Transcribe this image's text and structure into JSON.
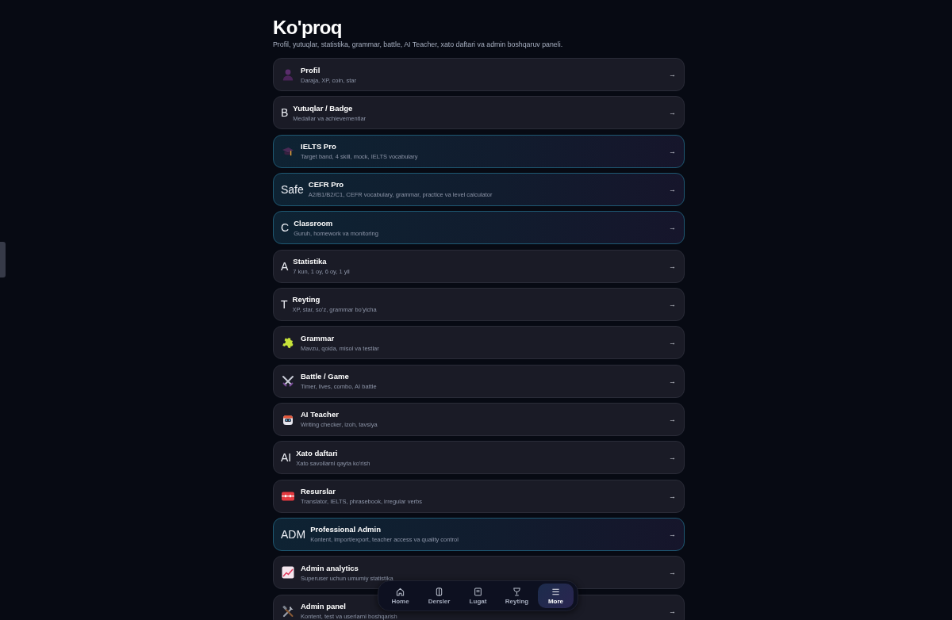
{
  "page": {
    "title": "Ko'proq",
    "subtitle": "Profil, yutuqlar, statistika, grammar, battle, AI Teacher, xato daftari va admin boshqaruv paneli."
  },
  "items": [
    {
      "kind": "icon",
      "title": "Profil",
      "subtitle": "Daraja, XP, coin, star",
      "featured": false,
      "arrow": "→"
    },
    {
      "kind": "glyph",
      "glyph": "B",
      "title": "Yutuqlar / Badge",
      "subtitle": "Medallar va achievementlar",
      "featured": false,
      "arrow": "→"
    },
    {
      "kind": "icon",
      "title": "IELTS Pro",
      "subtitle": "Target band, 4 skill, mock, IELTS vocabulary",
      "featured": true,
      "arrow": "→"
    },
    {
      "kind": "glyph",
      "glyph": "Safe",
      "title": "CEFR Pro",
      "subtitle": "A2/B1/B2/C1, CEFR vocabulary, grammar, practice va level calculator",
      "featured": true,
      "arrow": "→"
    },
    {
      "kind": "glyph",
      "glyph": "C",
      "title": "Classroom",
      "subtitle": "Guruh, homework va monitoring",
      "featured": true,
      "arrow": "→"
    },
    {
      "kind": "glyph",
      "glyph": "A",
      "title": "Statistika",
      "subtitle": "7 kun, 1 oy, 6 oy, 1 yil",
      "featured": false,
      "arrow": "→"
    },
    {
      "kind": "glyph",
      "glyph": "T",
      "title": "Reyting",
      "subtitle": "XP, star, so'z, grammar bo'yicha",
      "featured": false,
      "arrow": "→"
    },
    {
      "kind": "icon",
      "title": "Grammar",
      "subtitle": "Mavzu, qoida, misol va testlar",
      "featured": false,
      "arrow": "→"
    },
    {
      "kind": "icon",
      "title": "Battle / Game",
      "subtitle": "Timer, lives, combo, AI battle",
      "featured": false,
      "arrow": "→"
    },
    {
      "kind": "icon",
      "title": "AI Teacher",
      "subtitle": "Writing checker, izoh, tavsiya",
      "featured": false,
      "arrow": "→"
    },
    {
      "kind": "glyph",
      "glyph": "AI",
      "title": "Xato daftari",
      "subtitle": "Xato savollarni qayta ko'rish",
      "featured": false,
      "arrow": "→"
    },
    {
      "kind": "icon",
      "title": "Resurslar",
      "subtitle": "Translator, IELTS, phrasebook, irregular verbs",
      "featured": false,
      "arrow": "→"
    },
    {
      "kind": "glyph",
      "glyph": "ADM",
      "title": "Professional Admin",
      "subtitle": "Kontent, import/export, teacher access va quality control",
      "featured": true,
      "arrow": "→"
    },
    {
      "kind": "icon",
      "title": "Admin analytics",
      "subtitle": "Superuser uchun umumiy statistika",
      "featured": false,
      "arrow": "→"
    },
    {
      "kind": "icon",
      "title": "Admin panel",
      "subtitle": "Kontent, test va userlarni boshqarish",
      "featured": false,
      "arrow": "→"
    }
  ],
  "nav": {
    "tabs": [
      {
        "label": "Home",
        "selected": false
      },
      {
        "label": "Dersler",
        "selected": false
      },
      {
        "label": "Lugat",
        "selected": false
      },
      {
        "label": "Reyting",
        "selected": false
      },
      {
        "label": "More",
        "selected": true
      }
    ]
  }
}
